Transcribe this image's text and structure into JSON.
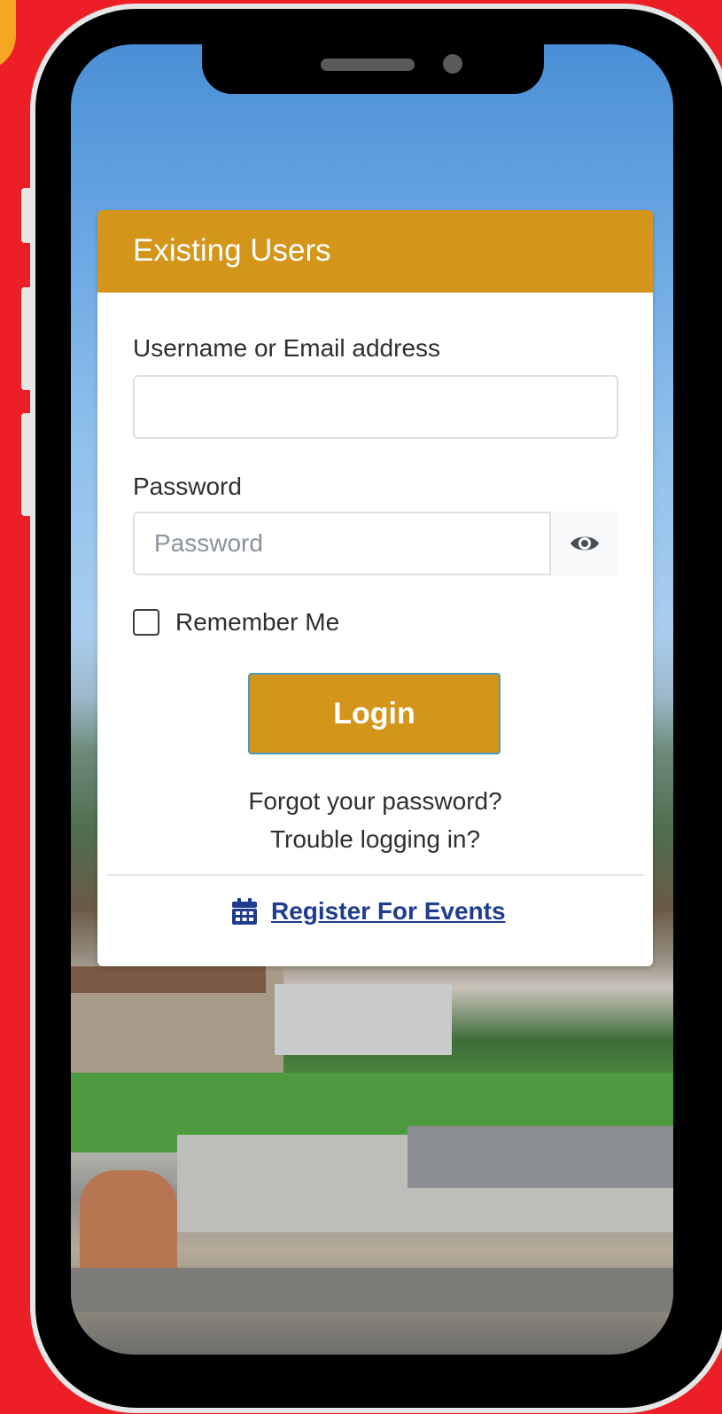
{
  "login_card": {
    "title": "Existing Users",
    "username_label": "Username or Email address",
    "username_value": "",
    "password_label": "Password",
    "password_placeholder": "Password",
    "password_value": "",
    "remember_label": "Remember Me",
    "remember_checked": false,
    "login_label": "Login",
    "forgot_password_label": "Forgot your password?",
    "trouble_label": "Trouble logging in?",
    "register_label": "Register For Events"
  },
  "colors": {
    "page_background": "#ec1f27",
    "brand_gold": "#d3951a",
    "link_blue": "#1f3c8f"
  },
  "icons": {
    "password_toggle": "eye-icon",
    "register": "calendar-icon"
  }
}
